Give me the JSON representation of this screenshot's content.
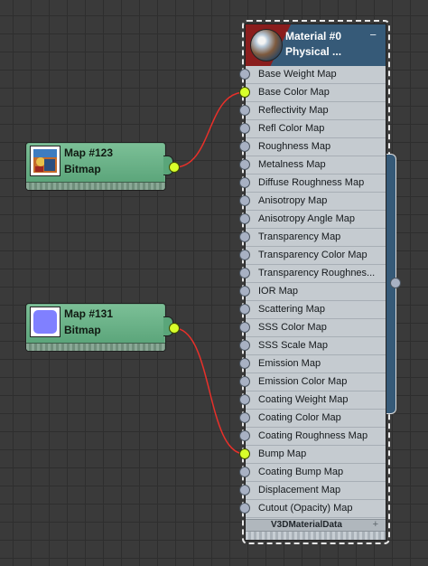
{
  "material": {
    "name": "Material #0",
    "type": "Physical ...",
    "collapse_symbol": "−",
    "slots": [
      {
        "label": "Base Weight Map",
        "connected": false
      },
      {
        "label": "Base Color Map",
        "connected": true
      },
      {
        "label": "Reflectivity Map",
        "connected": false
      },
      {
        "label": "Refl Color Map",
        "connected": false
      },
      {
        "label": "Roughness Map",
        "connected": false
      },
      {
        "label": "Metalness Map",
        "connected": false
      },
      {
        "label": "Diffuse Roughness Map",
        "connected": false
      },
      {
        "label": "Anisotropy Map",
        "connected": false
      },
      {
        "label": "Anisotropy Angle Map",
        "connected": false
      },
      {
        "label": "Transparency Map",
        "connected": false
      },
      {
        "label": "Transparency Color Map",
        "connected": false
      },
      {
        "label": "Transparency Roughnes...",
        "connected": false
      },
      {
        "label": "IOR Map",
        "connected": false
      },
      {
        "label": "Scattering Map",
        "connected": false
      },
      {
        "label": "SSS Color Map",
        "connected": false
      },
      {
        "label": "SSS Scale Map",
        "connected": false
      },
      {
        "label": "Emission Map",
        "connected": false
      },
      {
        "label": "Emission Color Map",
        "connected": false
      },
      {
        "label": "Coating Weight Map",
        "connected": false
      },
      {
        "label": "Coating Color Map",
        "connected": false
      },
      {
        "label": "Coating Roughness Map",
        "connected": false
      },
      {
        "label": "Bump Map",
        "connected": true
      },
      {
        "label": "Coating Bump Map",
        "connected": false
      },
      {
        "label": "Displacement Map",
        "connected": false
      },
      {
        "label": "Cutout (Opacity) Map",
        "connected": false
      }
    ],
    "footer_label": "V3DMaterialData",
    "footer_plus": "+"
  },
  "maps": [
    {
      "name": "Map #123",
      "type": "Bitmap",
      "thumb_icon": "image-thumbnail-icon",
      "connects_to": "Base Color Map"
    },
    {
      "name": "Map #131",
      "type": "Bitmap",
      "thumb_icon": "normal-map-thumbnail-icon",
      "thumb_color": "#8080ff",
      "connects_to": "Bump Map"
    }
  ],
  "colors": {
    "wire": "#e8302a",
    "socket_connected": "#d8ff2a",
    "socket_empty": "#a8b1c3",
    "map_node": "#5aa67a",
    "material_header": "#365a78"
  }
}
